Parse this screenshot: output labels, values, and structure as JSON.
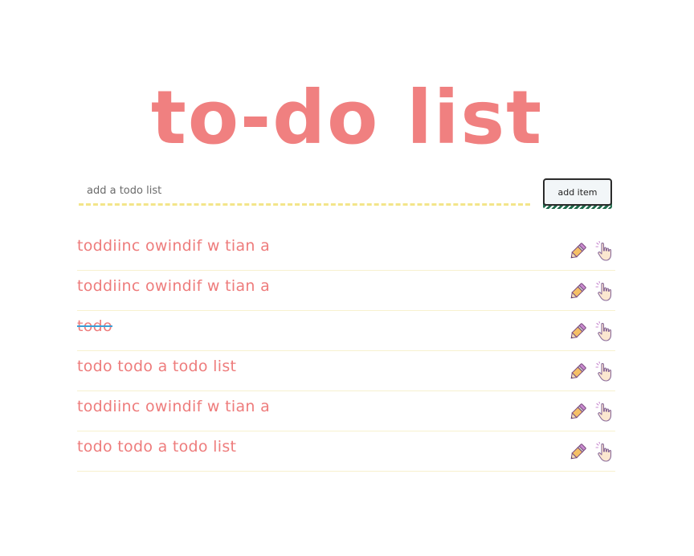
{
  "header": {
    "title": "to-do list"
  },
  "add_form": {
    "placeholder": "add a todo list",
    "value": "",
    "button_label": "add item"
  },
  "todos": [
    {
      "text": "toddiinc owindif w tian a",
      "done": false
    },
    {
      "text": "toddiinc owindif w tian a",
      "done": false
    },
    {
      "text": "todo",
      "done": true
    },
    {
      "text": "todo todo a todo list",
      "done": false
    },
    {
      "text": "toddiinc owindif w tian a",
      "done": false
    },
    {
      "text": "todo todo a todo list",
      "done": false
    }
  ],
  "icons": {
    "edit": "pencil-icon",
    "complete": "pointing-hand-icon"
  },
  "colors": {
    "title": "#f08080",
    "item_text": "#ee7c7c",
    "strike": "#3aa0d8",
    "input_underline": "#f3e58a",
    "button_shadow": "#1f6b4c"
  }
}
